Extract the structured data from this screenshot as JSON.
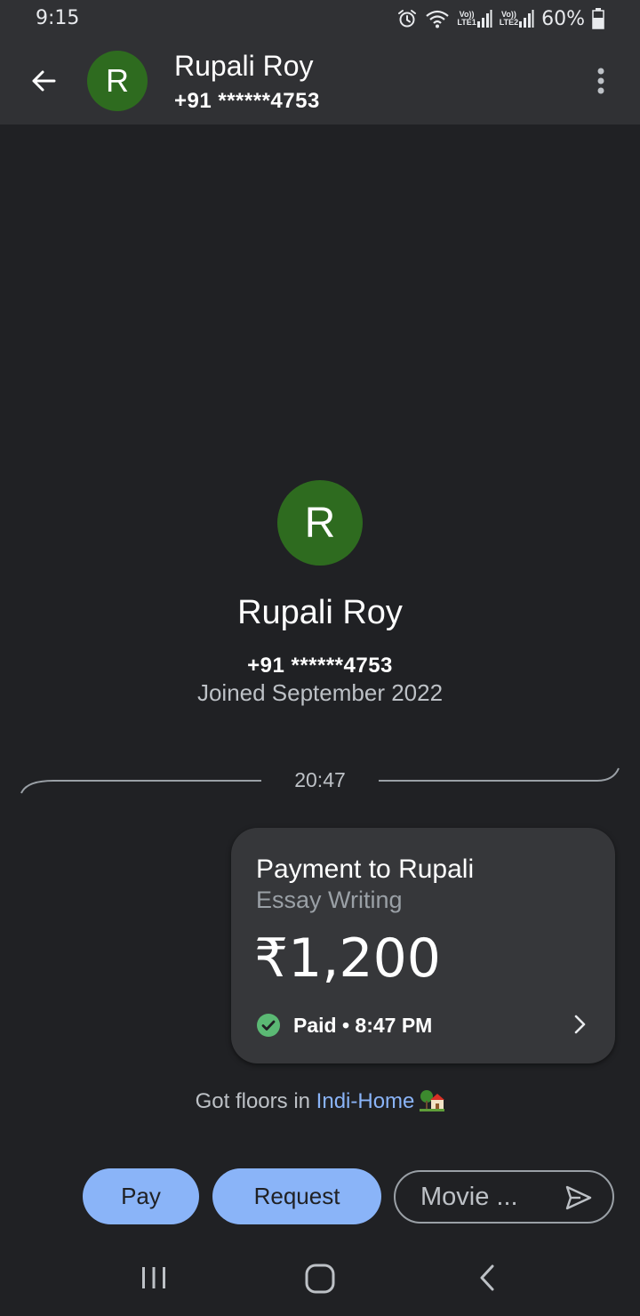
{
  "status_bar": {
    "time": "9:15",
    "sim1_label_top": "Vo))",
    "sim1_label_bottom": "LTE1",
    "sim2_label_top": "Vo))",
    "sim2_label_bottom": "LTE2",
    "battery_percent": "60%",
    "icons": [
      "alarm-icon",
      "wifi-icon",
      "signal-icon",
      "signal-icon",
      "battery-icon"
    ]
  },
  "header": {
    "avatar_letter": "R",
    "contact_name": "Rupali Roy",
    "contact_phone": "+91 ******4753",
    "avatar_color": "#2e6b1f"
  },
  "profile": {
    "avatar_letter": "R",
    "name": "Rupali Roy",
    "phone": "+91 ******4753",
    "joined": "Joined September 2022"
  },
  "conversation": {
    "timestamp": "20:47",
    "payment": {
      "title": "Payment to Rupali",
      "note": "Essay Writing",
      "amount": "₹1,200",
      "status": "Paid • 8:47 PM",
      "status_color": "#5bb974"
    },
    "offer": {
      "prefix": "Got floors in ",
      "link": "Indi-Home",
      "emoji_icon": "house-with-garden-icon"
    }
  },
  "actions": {
    "pay_label": "Pay",
    "request_label": "Request",
    "message_text": "Movie ...",
    "accent_color": "#8ab4f8"
  },
  "colors": {
    "background": "#202124",
    "app_bar": "#303134",
    "card": "#36373a"
  }
}
